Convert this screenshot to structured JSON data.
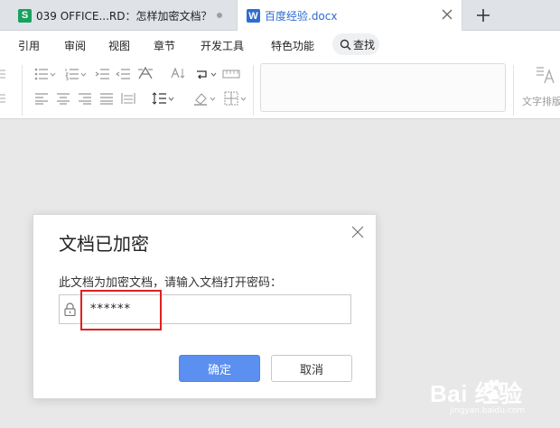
{
  "tabs": [
    {
      "icon": "spreadsheet-icon",
      "icon_letter": "S",
      "icon_color": "#1aa15f",
      "title": "039 OFFICE...RD：怎样加密文档？"
    },
    {
      "icon": "writer-doc-icon",
      "icon_letter": "W",
      "icon_color": "#2d6cd2",
      "title": "百度经验.docx"
    }
  ],
  "menu": {
    "items": [
      "引用",
      "审阅",
      "视图",
      "章节",
      "开发工具",
      "特色功能"
    ],
    "search_label": "查找"
  },
  "toolbar": {
    "wrap_label": "文字排版"
  },
  "dialog": {
    "title": "文档已加密",
    "message": "此文档为加密文档，请输入文档打开密码：",
    "password_value": "******",
    "ok_label": "确定",
    "cancel_label": "取消",
    "accent_color": "#5b8ff0"
  },
  "highlight_color": "#e02020",
  "watermark": {
    "brand": "Bai  经验",
    "sub": "jingyan.baidu.com"
  }
}
